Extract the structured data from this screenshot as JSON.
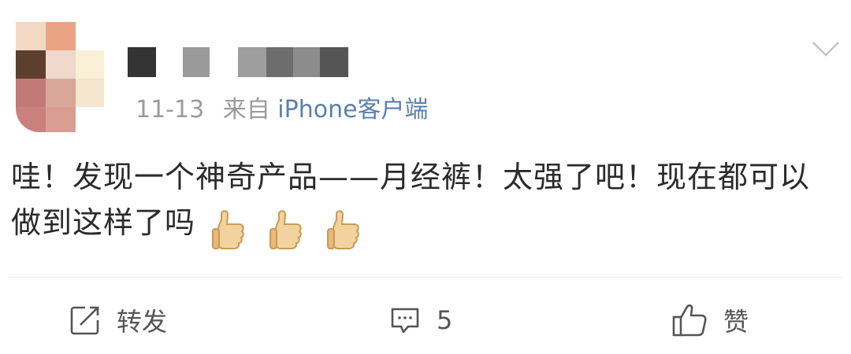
{
  "post": {
    "timestamp": "11-13",
    "source_prefix": "来自",
    "source": "iPhone客户端",
    "text": "哇！发现一个神奇产品——月经裤！太强了吧！现在都可以做到这样了吗",
    "emoji_icons": [
      "thumbs-up-icon",
      "thumbs-up-icon",
      "thumbs-up-icon"
    ],
    "colors": {
      "source_link": "#5b7fae",
      "meta_text": "#9b9b9b",
      "body_text": "#2b2b2b",
      "action_text": "#555555"
    }
  },
  "actions": {
    "repost_label": "转发",
    "comment_count": "5",
    "like_label": "赞"
  }
}
